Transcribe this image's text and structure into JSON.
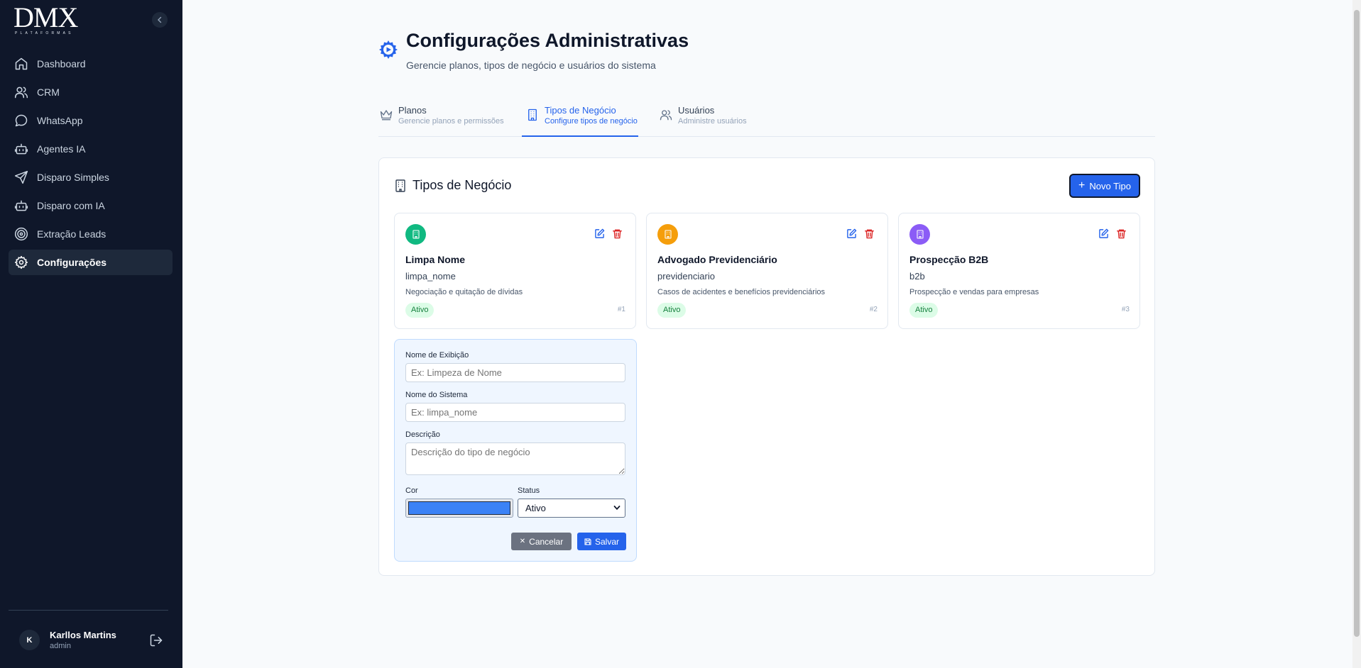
{
  "sidebar": {
    "logo_text": "DMX",
    "logo_subtext": "PLATAFORMAS",
    "items": [
      {
        "label": "Dashboard",
        "icon": "home-icon"
      },
      {
        "label": "CRM",
        "icon": "users-icon"
      },
      {
        "label": "WhatsApp",
        "icon": "message-circle-icon"
      },
      {
        "label": "Agentes IA",
        "icon": "bot-icon"
      },
      {
        "label": "Disparo Simples",
        "icon": "send-icon"
      },
      {
        "label": "Disparo com IA",
        "icon": "bot-icon"
      },
      {
        "label": "Extração Leads",
        "icon": "target-icon"
      },
      {
        "label": "Configurações",
        "icon": "gear-icon",
        "active": true
      }
    ],
    "user": {
      "initial": "K",
      "name": "Karllos Martins",
      "role": "admin"
    }
  },
  "header": {
    "title": "Configurações Administrativas",
    "subtitle": "Gerencie planos, tipos de negócio e usuários do sistema"
  },
  "tabs": [
    {
      "label": "Planos",
      "desc": "Gerencie planos e permissões",
      "icon": "crown-icon"
    },
    {
      "label": "Tipos de Negócio",
      "desc": "Configure tipos de negócio",
      "icon": "building-icon",
      "active": true
    },
    {
      "label": "Usuários",
      "desc": "Administre usuários",
      "icon": "users-icon"
    }
  ],
  "panel": {
    "title": "Tipos de Negócio",
    "new_button": "Novo Tipo"
  },
  "cards": [
    {
      "name": "Limpa Nome",
      "system": "limpa_nome",
      "desc": "Negociação e quitação de dívidas",
      "status": "Ativo",
      "num": "#1",
      "color": "#10b981"
    },
    {
      "name": "Advogado Previdenciário",
      "system": "previdenciario",
      "desc": "Casos de acidentes e benefícios previdenciários",
      "status": "Ativo",
      "num": "#2",
      "color": "#f59e0b"
    },
    {
      "name": "Prospecção B2B",
      "system": "b2b",
      "desc": "Prospecção e vendas para empresas",
      "status": "Ativo",
      "num": "#3",
      "color": "#8b5cf6"
    }
  ],
  "form": {
    "display_label": "Nome de Exibição",
    "display_placeholder": "Ex: Limpeza de Nome",
    "system_label": "Nome do Sistema",
    "system_placeholder": "Ex: limpa_nome",
    "desc_label": "Descrição",
    "desc_placeholder": "Descrição do tipo de negócio",
    "color_label": "Cor",
    "color_value": "#3b82f6",
    "status_label": "Status",
    "status_value": "Ativo",
    "cancel": "Cancelar",
    "save": "Salvar"
  }
}
